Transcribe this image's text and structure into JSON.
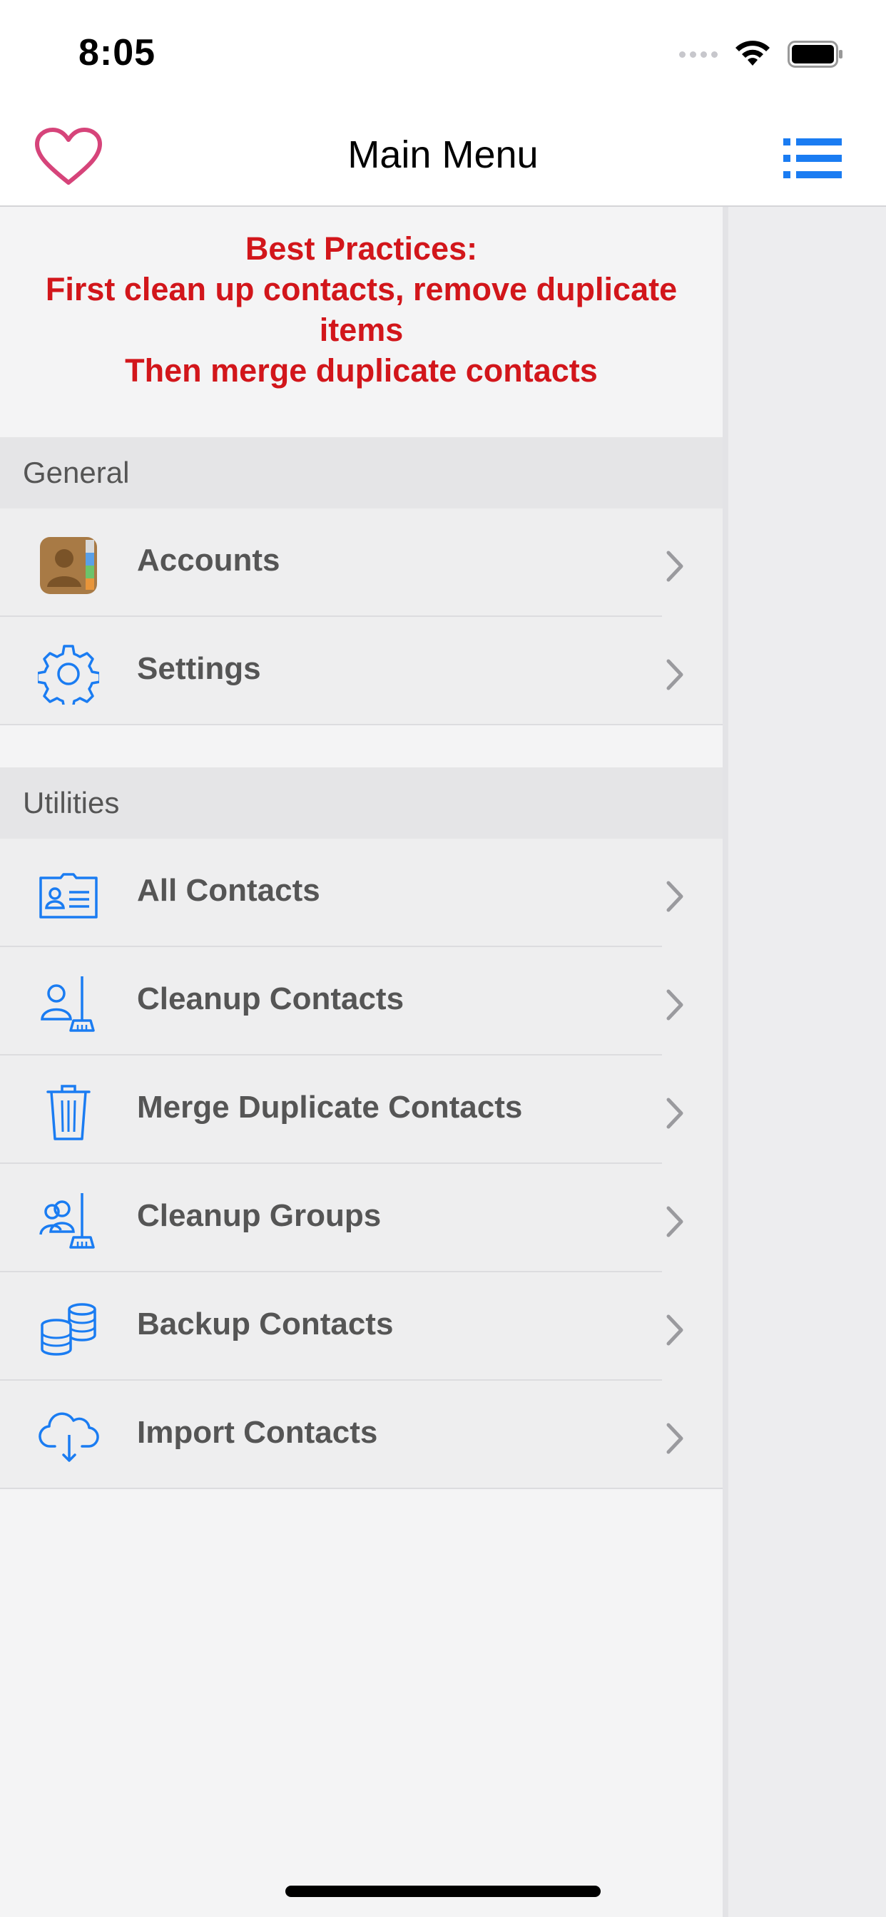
{
  "status_bar": {
    "time": "8:05"
  },
  "nav": {
    "title": "Main Menu"
  },
  "best_practices": {
    "line1": "Best Practices:",
    "line2": "First clean up contacts, remove duplicate",
    "line3": "items",
    "line4": "Then merge duplicate contacts"
  },
  "sections": {
    "general": {
      "title": "General",
      "items": [
        {
          "label": "Accounts",
          "icon": "contacts-book-icon"
        },
        {
          "label": "Settings",
          "icon": "gear-icon"
        }
      ]
    },
    "utilities": {
      "title": "Utilities",
      "items": [
        {
          "label": "All Contacts",
          "icon": "contact-card-icon"
        },
        {
          "label": "Cleanup Contacts",
          "icon": "person-broom-icon"
        },
        {
          "label": "Merge Duplicate Contacts",
          "icon": "trash-icon"
        },
        {
          "label": "Cleanup Groups",
          "icon": "group-broom-icon"
        },
        {
          "label": "Backup Contacts",
          "icon": "database-stack-icon"
        },
        {
          "label": "Import Contacts",
          "icon": "cloud-download-icon"
        }
      ]
    }
  },
  "colors": {
    "accent": "#1a7cf2",
    "warning_text": "#d2161b",
    "heart": "#d6447a"
  }
}
